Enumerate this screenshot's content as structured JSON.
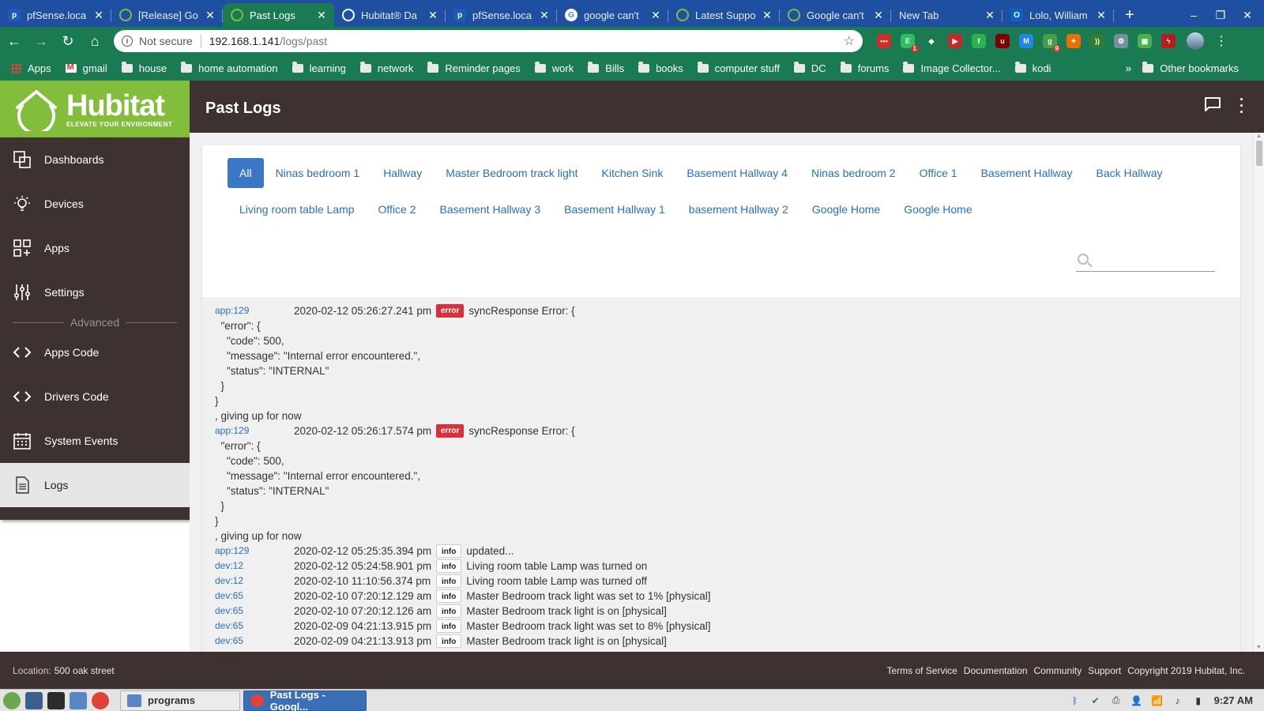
{
  "browser": {
    "tabs": [
      {
        "title": "pfSense.loca",
        "favicon": "pfsense-icon",
        "color": "#1f5bb5",
        "active": false
      },
      {
        "title": "[Release] Go",
        "favicon": "hubitat-icon",
        "color": "#82bd3b",
        "active": false
      },
      {
        "title": "Past Logs",
        "favicon": "hubitat-icon",
        "color": "#82bd3b",
        "active": true
      },
      {
        "title": "Hubitat® Da",
        "favicon": "globe-icon",
        "color": "#ffffff",
        "active": false
      },
      {
        "title": "pfSense.loca",
        "favicon": "pfsense-icon",
        "color": "#1f5bb5",
        "active": false
      },
      {
        "title": "google can't",
        "favicon": "google-icon",
        "color": "#ffffff",
        "active": false
      },
      {
        "title": "Latest Suppo",
        "favicon": "hubitat-icon",
        "color": "#82bd3b",
        "active": false
      },
      {
        "title": "Google can't",
        "favicon": "hubitat-icon",
        "color": "#82bd3b",
        "active": false
      },
      {
        "title": "New Tab",
        "favicon": "",
        "color": "",
        "active": false
      },
      {
        "title": "Lolo, William",
        "favicon": "outlook-icon",
        "color": "#0a64c8",
        "active": false
      }
    ],
    "tab_close_glyph": "✕",
    "new_tab_glyph": "+",
    "window_controls": [
      "–",
      "❐",
      "✕"
    ],
    "nav": {
      "back": "←",
      "forward": "→",
      "reload": "↻",
      "home": "⌂"
    },
    "omnibox": {
      "info_glyph": "i",
      "security_label": "Not secure",
      "host": "192.168.1.141",
      "path": "/logs/past",
      "star_glyph": "☆"
    },
    "extensions": [
      {
        "name": "lastpass-icon",
        "color": "#d32d27",
        "label": "•••",
        "badge": ""
      },
      {
        "name": "evernote-icon",
        "color": "#2dbe60",
        "label": "E",
        "badge": "1"
      },
      {
        "name": "diamond-icon",
        "color": "#1a7a52",
        "label": "◆",
        "badge": ""
      },
      {
        "name": "media-icon",
        "color": "#c62828",
        "label": "▶",
        "badge": ""
      },
      {
        "name": "feedly-icon",
        "color": "#2bb24c",
        "label": "f",
        "badge": ""
      },
      {
        "name": "ublock-icon",
        "color": "#800000",
        "label": "u",
        "badge": ""
      },
      {
        "name": "mailtrack-icon",
        "color": "#1e88e5",
        "label": "M",
        "badge": ""
      },
      {
        "name": "notifier-icon",
        "color": "#43a047",
        "label": "g",
        "badge": "9"
      },
      {
        "name": "fire-icon",
        "color": "#ef6c00",
        "label": "✦",
        "badge": ""
      },
      {
        "name": "rss-icon",
        "color": "#2e7d32",
        "label": "))",
        "badge": ""
      },
      {
        "name": "gear-ext-icon",
        "color": "#78909c",
        "label": "⚙",
        "badge": ""
      },
      {
        "name": "screenshot-icon",
        "color": "#4caf50",
        "label": "▣",
        "badge": ""
      },
      {
        "name": "bolt-icon",
        "color": "#b71c1c",
        "label": "ϟ",
        "badge": ""
      }
    ],
    "menu_glyph": "⋮",
    "bookmarks": [
      {
        "label": "Apps",
        "kind": "apps"
      },
      {
        "label": "gmail",
        "kind": "gmail"
      },
      {
        "label": "house",
        "kind": "folder"
      },
      {
        "label": "home automation",
        "kind": "folder"
      },
      {
        "label": "learning",
        "kind": "folder"
      },
      {
        "label": "network",
        "kind": "folder"
      },
      {
        "label": "Reminder pages",
        "kind": "folder"
      },
      {
        "label": "work",
        "kind": "folder"
      },
      {
        "label": "Bills",
        "kind": "folder"
      },
      {
        "label": "books",
        "kind": "folder"
      },
      {
        "label": "computer stuff",
        "kind": "folder"
      },
      {
        "label": "DC",
        "kind": "folder"
      },
      {
        "label": "forums",
        "kind": "folder"
      },
      {
        "label": "Image Collector...",
        "kind": "folder"
      },
      {
        "label": "kodi",
        "kind": "folder"
      }
    ],
    "bookmarks_more": "»",
    "other_bookmarks": "Other bookmarks"
  },
  "hubitat": {
    "logo": {
      "brand": "Hubitat",
      "tagline": "ELEVATE YOUR ENVIRONMENT",
      "color": "#82bd3b"
    },
    "page_title": "Past Logs",
    "header_color": "#3d3230",
    "nav": [
      {
        "id": "dashboards",
        "label": "Dashboards",
        "icon": "dashboards-icon"
      },
      {
        "id": "devices",
        "label": "Devices",
        "icon": "lightbulb-icon"
      },
      {
        "id": "apps",
        "label": "Apps",
        "icon": "apps-grid-icon"
      },
      {
        "id": "settings",
        "label": "Settings",
        "icon": "sliders-icon"
      }
    ],
    "advanced_label": "Advanced",
    "nav_advanced": [
      {
        "id": "apps-code",
        "label": "Apps Code",
        "icon": "code-icon"
      },
      {
        "id": "drivers-code",
        "label": "Drivers Code",
        "icon": "code-icon"
      },
      {
        "id": "system-events",
        "label": "System Events",
        "icon": "calendar-icon"
      },
      {
        "id": "logs",
        "label": "Logs",
        "icon": "document-icon",
        "active": true
      }
    ],
    "filters": [
      {
        "label": "All",
        "active": true
      },
      {
        "label": "Ninas bedroom 1"
      },
      {
        "label": "Hallway"
      },
      {
        "label": "Master Bedroom track light"
      },
      {
        "label": "Kitchen Sink"
      },
      {
        "label": "Basement Hallway 4"
      },
      {
        "label": "Ninas bedroom 2"
      },
      {
        "label": "Office 1"
      },
      {
        "label": "Basement Hallway"
      },
      {
        "label": "Back Hallway"
      },
      {
        "label": "Living room table Lamp"
      },
      {
        "label": "Office 2"
      },
      {
        "label": "Basement Hallway 3"
      },
      {
        "label": "Basement Hallway 1"
      },
      {
        "label": "basement Hallway 2"
      },
      {
        "label": "Google Home"
      },
      {
        "label": "Google Home"
      }
    ],
    "search": {
      "value": "",
      "placeholder": ""
    },
    "logs": [
      {
        "src": "app:129",
        "time": "2020-02-12 05:26:27.241 pm",
        "level": "error",
        "msg": "syncResponse Error: {",
        "cont": [
          "  \"error\": {",
          "    \"code\": 500,",
          "    \"message\": \"Internal error encountered.\",",
          "    \"status\": \"INTERNAL\"",
          "  }",
          "}",
          ", giving up for now"
        ]
      },
      {
        "src": "app:129",
        "time": "2020-02-12 05:26:17.574 pm",
        "level": "error",
        "msg": "syncResponse Error: {",
        "cont": [
          "  \"error\": {",
          "    \"code\": 500,",
          "    \"message\": \"Internal error encountered.\",",
          "    \"status\": \"INTERNAL\"",
          "  }",
          "}",
          ", giving up for now"
        ]
      },
      {
        "src": "app:129",
        "time": "2020-02-12 05:25:35.394 pm",
        "level": "info",
        "msg": "updated...",
        "cont": []
      },
      {
        "src": "dev:12",
        "time": "2020-02-12 05:24:58.901 pm",
        "level": "info",
        "msg": "Living room table Lamp was turned on",
        "cont": []
      },
      {
        "src": "dev:12",
        "time": "2020-02-10 11:10:56.374 pm",
        "level": "info",
        "msg": "Living room table Lamp was turned off",
        "cont": []
      },
      {
        "src": "dev:65",
        "time": "2020-02-10 07:20:12.129 am",
        "level": "info",
        "msg": "Master Bedroom track light was set to 1% [physical]",
        "cont": []
      },
      {
        "src": "dev:65",
        "time": "2020-02-10 07:20:12.126 am",
        "level": "info",
        "msg": "Master Bedroom track light is on [physical]",
        "cont": []
      },
      {
        "src": "dev:65",
        "time": "2020-02-09 04:21:13.915 pm",
        "level": "info",
        "msg": "Master Bedroom track light was set to 8% [physical]",
        "cont": []
      },
      {
        "src": "dev:65",
        "time": "2020-02-09 04:21:13.913 pm",
        "level": "info",
        "msg": "Master Bedroom track light is on [physical]",
        "cont": []
      }
    ],
    "footer": {
      "location_label": "Location:",
      "location_value": "500 oak street",
      "links": [
        "Terms of Service",
        "Documentation",
        "Community",
        "Support",
        "Copyright 2019 Hubitat, Inc."
      ]
    }
  },
  "taskbar": {
    "launchers": [
      {
        "name": "mint-menu-icon",
        "color": "#6aa84f"
      },
      {
        "name": "show-desktop-icon",
        "color": "#3b5f8f"
      },
      {
        "name": "terminal-icon",
        "color": "#2b2b2b"
      },
      {
        "name": "files-icon",
        "color": "#5b86c5"
      },
      {
        "name": "chrome-icon",
        "color": "#db4437"
      }
    ],
    "windows": [
      {
        "label": "programs",
        "icon": "folder-window-icon",
        "active": false
      },
      {
        "label": "Past Logs - Googl...",
        "icon": "chrome-window-icon",
        "active": true
      }
    ],
    "tray": [
      "bluetooth-icon",
      "shield-check-icon",
      "printer-icon",
      "user-icon",
      "wifi-icon",
      "volume-icon",
      "battery-icon"
    ],
    "clock": "9:27 AM"
  }
}
